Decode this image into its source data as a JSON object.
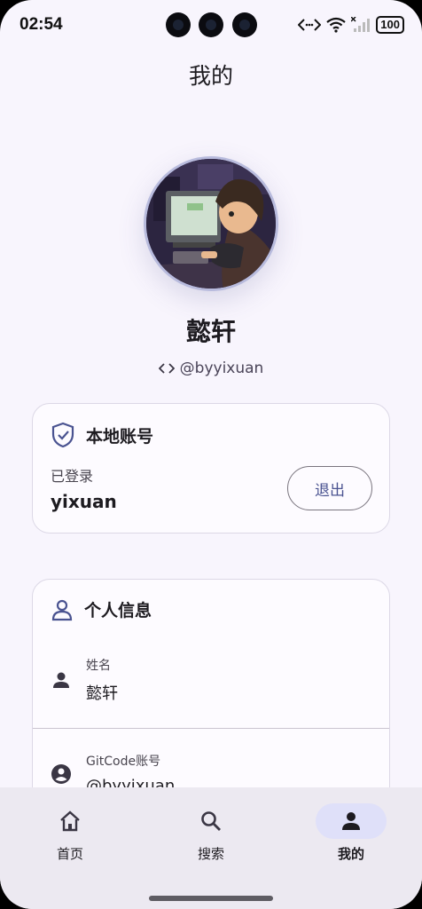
{
  "status_bar": {
    "time": "02:54",
    "battery": "100"
  },
  "header": {
    "title": "我的"
  },
  "profile": {
    "name": "懿轩",
    "handle": "@byyixuan"
  },
  "local_account": {
    "title": "本地账号",
    "status_label": "已登录",
    "username": "yixuan",
    "logout_label": "退出"
  },
  "personal_info": {
    "title": "个人信息",
    "rows": [
      {
        "label": "姓名",
        "value": "懿轩"
      },
      {
        "label": "GitCode账号",
        "value": "@byyixuan"
      }
    ]
  },
  "bottom_nav": {
    "items": [
      {
        "label": "首页",
        "icon": "home-icon"
      },
      {
        "label": "搜索",
        "icon": "search-icon"
      },
      {
        "label": "我的",
        "icon": "person-icon",
        "active": true
      }
    ]
  },
  "colors": {
    "accent": "#4a5391",
    "active_pill": "#dfe0f9",
    "background": "#f8f5fd"
  }
}
